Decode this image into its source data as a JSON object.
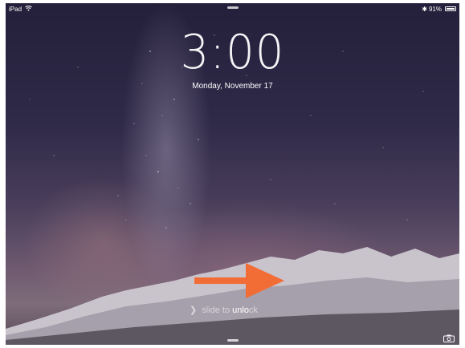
{
  "status_bar": {
    "carrier": "iPad",
    "wifi_icon": "wifi-icon",
    "bluetooth": "✱",
    "battery_percent": "91%",
    "battery_icon": "battery-icon"
  },
  "lock_screen": {
    "time": "3:00",
    "date": "Monday, November 17",
    "slide_text_pre": "slide to ",
    "slide_text_highlight": "unlo",
    "slide_text_post": "ck",
    "camera_icon": "camera-icon"
  },
  "annotation": {
    "arrow_color": "#f26c35",
    "arrow_icon": "arrow-right-icon"
  }
}
